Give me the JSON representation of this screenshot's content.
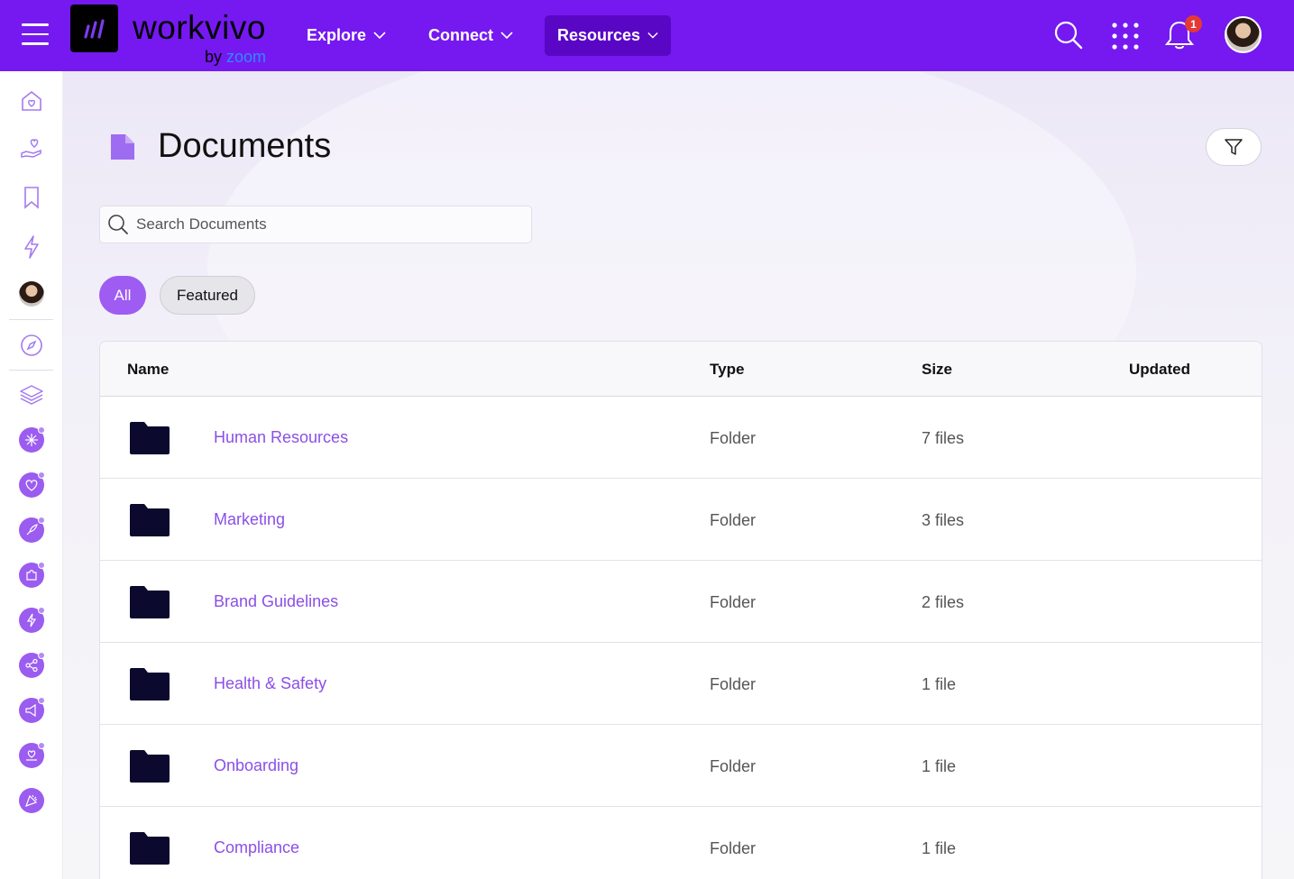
{
  "app": {
    "logo_text": "workvivo",
    "logo_by": "by",
    "logo_zoom": "zoom"
  },
  "nav": {
    "items": [
      {
        "label": "Explore"
      },
      {
        "label": "Connect"
      },
      {
        "label": "Resources"
      }
    ],
    "notification_count": "1"
  },
  "page": {
    "title": "Documents",
    "search_placeholder": "Search Documents",
    "filters": [
      {
        "label": "All",
        "active": true
      },
      {
        "label": "Featured",
        "active": false
      }
    ]
  },
  "table": {
    "columns": [
      "Name",
      "Type",
      "Size",
      "Updated"
    ],
    "rows": [
      {
        "name": "Human Resources",
        "type": "Folder",
        "size": "7 files"
      },
      {
        "name": "Marketing",
        "type": "Folder",
        "size": "3 files"
      },
      {
        "name": "Brand Guidelines",
        "type": "Folder",
        "size": "2 files"
      },
      {
        "name": "Health & Safety",
        "type": "Folder",
        "size": "1 file"
      },
      {
        "name": "Onboarding",
        "type": "Folder",
        "size": "1 file"
      },
      {
        "name": "Compliance",
        "type": "Folder",
        "size": "1 file"
      }
    ]
  },
  "colors": {
    "brand": "#7519f0",
    "accent": "#9e5cf2",
    "link": "#8b4fe6"
  },
  "icons": {
    "sidebar": [
      "home-icon",
      "hand-heart-icon",
      "bookmark-icon",
      "lightning-icon",
      "avatar",
      "compass-icon",
      "layers-icon"
    ],
    "spaces": [
      "snowflake-space-icon",
      "heart-space-icon",
      "rocket-space-icon",
      "puzzle-space-icon",
      "bolt-space-icon",
      "share-space-icon",
      "megaphone-space-icon",
      "hand-heart-space-icon",
      "party-space-icon"
    ]
  }
}
